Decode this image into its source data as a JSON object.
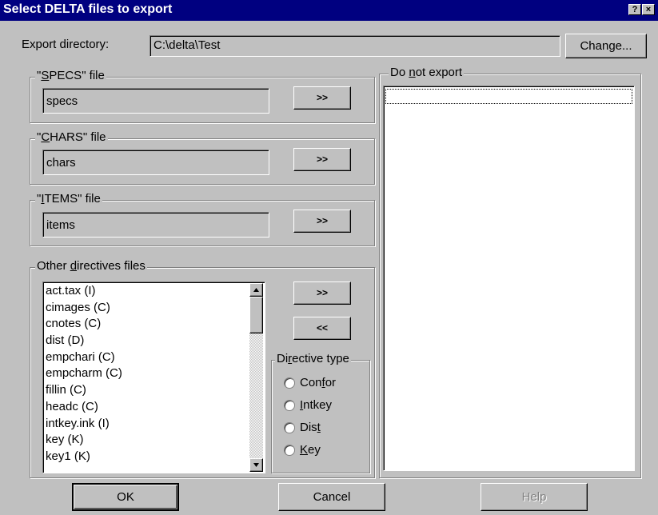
{
  "window": {
    "title": "Select DELTA files to export",
    "help_button": "?",
    "close_button": "×"
  },
  "export_dir": {
    "label": "Export directory:",
    "value": "C:\\delta\\Test",
    "change_button": "Change..."
  },
  "specs": {
    "label_pre": "\"",
    "label_ul": "S",
    "label_post": "PECS\" file",
    "value": "specs",
    "button": ">>"
  },
  "chars": {
    "label_pre": "\"",
    "label_ul": "C",
    "label_post": "HARS\" file",
    "value": "chars",
    "button": ">>"
  },
  "items": {
    "label_pre": "\"",
    "label_ul": "I",
    "label_post": "TEMS\" file",
    "value": "items",
    "button": ">>"
  },
  "directives": {
    "label_pre": "Other ",
    "label_ul": "d",
    "label_post": "irectives files",
    "files": [
      "act.tax (I)",
      "cimages (C)",
      "cnotes (C)",
      "dist (D)",
      "empchari (C)",
      "empcharm (C)",
      "fillin (C)",
      "headc (C)",
      "intkey.ink (I)",
      "key (K)",
      "key1 (K)"
    ],
    "add_button": ">>",
    "remove_button": "<<",
    "type_group": {
      "label_pre": "Di",
      "label_ul": "r",
      "label_post": "ective type",
      "options": [
        {
          "pre": "Con",
          "ul": "f",
          "post": "or"
        },
        {
          "pre": "",
          "ul": "I",
          "post": "ntkey"
        },
        {
          "pre": "Dis",
          "ul": "t",
          "post": ""
        },
        {
          "pre": "",
          "ul": "K",
          "post": "ey"
        }
      ]
    }
  },
  "do_not_export": {
    "label_pre": "Do ",
    "label_ul": "n",
    "label_post": "ot export"
  },
  "buttons": {
    "ok": "OK",
    "cancel": "Cancel",
    "help": "Help"
  }
}
